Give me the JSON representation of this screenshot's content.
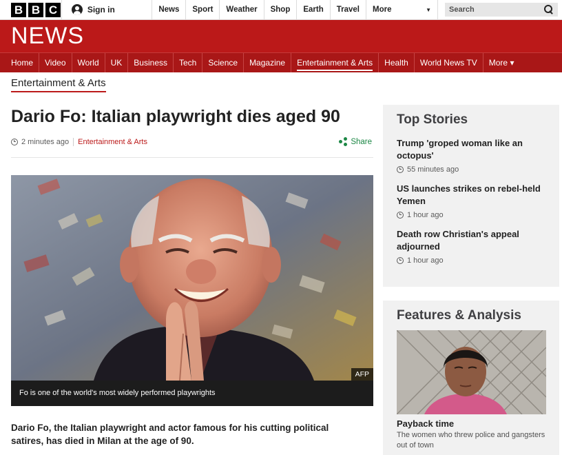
{
  "topbar": {
    "logo_letters": [
      "B",
      "B",
      "C"
    ],
    "signin_label": "Sign in",
    "nav": [
      "News",
      "Sport",
      "Weather",
      "Shop",
      "Earth",
      "Travel"
    ],
    "more_label": "More",
    "search_placeholder": "Search"
  },
  "banner": {
    "title": "NEWS"
  },
  "mainnav": {
    "items": [
      "Home",
      "Video",
      "World",
      "UK",
      "Business",
      "Tech",
      "Science",
      "Magazine",
      "Entertainment & Arts",
      "Health",
      "World News TV",
      "More ▾"
    ],
    "active": "Entertainment & Arts"
  },
  "section": {
    "title": "Entertainment & Arts"
  },
  "article": {
    "headline": "Dario Fo: Italian playwright dies aged 90",
    "time": "2 minutes ago",
    "category": "Entertainment & Arts",
    "share_label": "Share",
    "image_credit": "AFP",
    "caption": "Fo is one of the world's most widely performed playwrights",
    "lede": "Dario Fo, the Italian playwright and actor famous for his cutting political satires, has died in Milan at the age of 90."
  },
  "top_stories": {
    "heading": "Top Stories",
    "items": [
      {
        "title": "Trump 'groped woman like an octopus'",
        "time": "55 minutes ago"
      },
      {
        "title": "US launches strikes on rebel-held Yemen",
        "time": "1 hour ago"
      },
      {
        "title": "Death row Christian's appeal adjourned",
        "time": "1 hour ago"
      }
    ]
  },
  "features": {
    "heading": "Features & Analysis",
    "item": {
      "title": "Payback time",
      "subtitle": "The women who threw police and gangsters out of town"
    }
  },
  "colors": {
    "brand_red": "#bb1919",
    "nav_red": "#a91717",
    "share_green": "#1c8745"
  }
}
